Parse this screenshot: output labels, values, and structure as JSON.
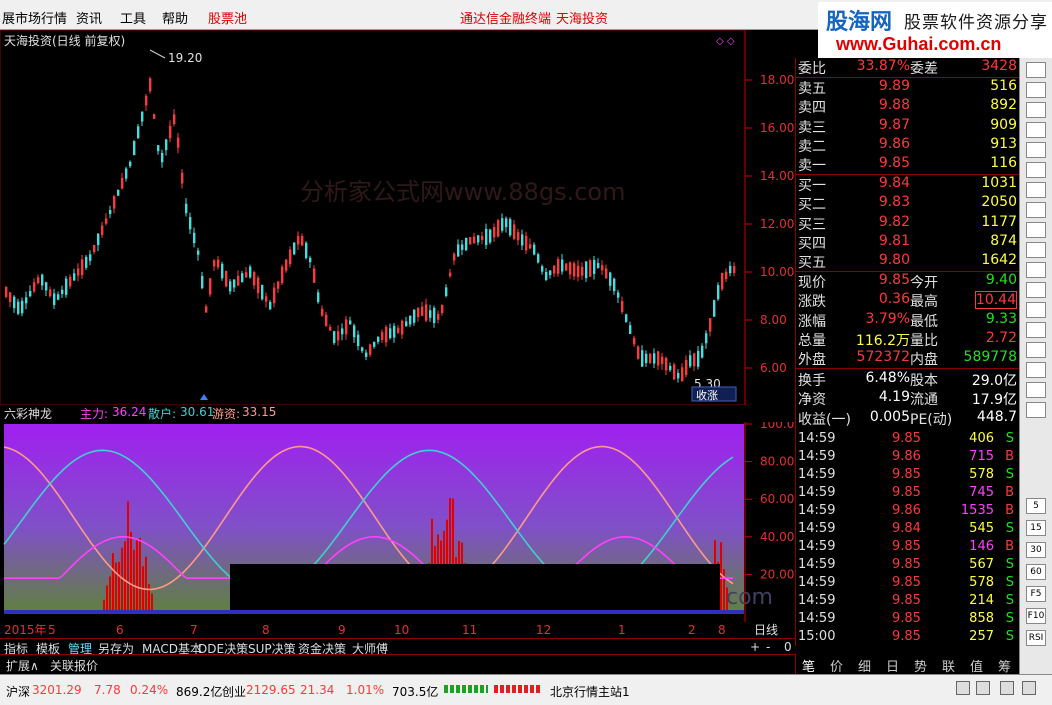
{
  "menu": {
    "items": [
      "展市场行情",
      "资讯",
      "工具",
      "帮助"
    ],
    "stock_pool": "股票池",
    "center_a": "通达信金融终端",
    "center_b": "天海投资"
  },
  "logo": {
    "title": "股海网",
    "subtitle": "股票软件资源分享",
    "url": "www.Guhai.com.cn"
  },
  "chart": {
    "title": "天海投资(日线 前复权)",
    "high_label": "19.20",
    "low_label": "5.30",
    "watermark": "分析家公式网www.88gs.com",
    "badge": "收涨",
    "y_ticks": [
      "18.00",
      "16.00",
      "14.00",
      "12.00",
      "10.00",
      "8.00",
      "6.00"
    ]
  },
  "indicator": {
    "name": "六彩神龙",
    "zhuli_label": "主力:",
    "zhuli_value": "36.24",
    "sanhu_label": "散户:",
    "sanhu_value": "30.61",
    "youzi_label": "游资:",
    "youzi_value": "33.15",
    "y_ticks": [
      "100.0",
      "80.00",
      "60.00",
      "40.00",
      "20.00"
    ],
    "watermark_tail": "com"
  },
  "xaxis": {
    "labels": [
      "2015年",
      "5",
      "6",
      "7",
      "8",
      "9",
      "10",
      "11",
      "12",
      "1",
      "2",
      "8"
    ],
    "period": "日线"
  },
  "tabs": [
    "指标",
    "模板",
    "管理",
    "另存为",
    "MACD基本",
    "DDE决策",
    "SUP决策",
    "资金决策",
    "大师傅"
  ],
  "tabs_row2": [
    "扩展∧",
    "关联报价"
  ],
  "zoom": {
    "plus": "+",
    "minus": "-",
    "zero": "0"
  },
  "quote": {
    "weibi_label": "委比",
    "weibi": "33.87%",
    "weicha_label": "委差",
    "weicha": "3428",
    "asks": [
      {
        "label": "卖五",
        "price": "9.89",
        "vol": "516"
      },
      {
        "label": "卖四",
        "price": "9.88",
        "vol": "892"
      },
      {
        "label": "卖三",
        "price": "9.87",
        "vol": "909"
      },
      {
        "label": "卖二",
        "price": "9.86",
        "vol": "913"
      },
      {
        "label": "卖一",
        "price": "9.85",
        "vol": "116"
      }
    ],
    "bids": [
      {
        "label": "买一",
        "price": "9.84",
        "vol": "1031"
      },
      {
        "label": "买二",
        "price": "9.83",
        "vol": "2050"
      },
      {
        "label": "买三",
        "price": "9.82",
        "vol": "1177"
      },
      {
        "label": "买四",
        "price": "9.81",
        "vol": "874"
      },
      {
        "label": "买五",
        "price": "9.80",
        "vol": "1642"
      }
    ],
    "stats": [
      {
        "l1": "现价",
        "v1": "9.85",
        "c1": "red",
        "l2": "今开",
        "v2": "9.40",
        "c2": "green"
      },
      {
        "l1": "涨跌",
        "v1": "0.36",
        "c1": "red",
        "l2": "最高",
        "v2": "10.44",
        "c2": "red"
      },
      {
        "l1": "涨幅",
        "v1": "3.79%",
        "c1": "red",
        "l2": "最低",
        "v2": "9.33",
        "c2": "green"
      },
      {
        "l1": "总量",
        "v1": "116.2万",
        "c1": "yellow",
        "l2": "量比",
        "v2": "2.72",
        "c2": "red"
      },
      {
        "l1": "外盘",
        "v1": "572372",
        "c1": "red",
        "l2": "内盘",
        "v2": "589778",
        "c2": "green"
      }
    ],
    "stats2": [
      {
        "l1": "换手",
        "v1": "6.48%",
        "l2": "股本",
        "v2": "29.0亿"
      },
      {
        "l1": "净资",
        "v1": "4.19",
        "l2": "流通",
        "v2": "17.9亿"
      },
      {
        "l1": "收益(一)",
        "v1": "0.005",
        "l2": "PE(动)",
        "v2": "448.7"
      }
    ]
  },
  "ticks": [
    {
      "time": "14:59",
      "price": "9.85",
      "vol": "406",
      "bs": "S"
    },
    {
      "time": "14:59",
      "price": "9.86",
      "vol": "715",
      "bs": "B"
    },
    {
      "time": "14:59",
      "price": "9.85",
      "vol": "578",
      "bs": "S"
    },
    {
      "time": "14:59",
      "price": "9.85",
      "vol": "745",
      "bs": "B"
    },
    {
      "time": "14:59",
      "price": "9.86",
      "vol": "1535",
      "bs": "B"
    },
    {
      "time": "14:59",
      "price": "9.84",
      "vol": "545",
      "bs": "S"
    },
    {
      "time": "14:59",
      "price": "9.85",
      "vol": "146",
      "bs": "B"
    },
    {
      "time": "14:59",
      "price": "9.85",
      "vol": "567",
      "bs": "S"
    },
    {
      "time": "14:59",
      "price": "9.85",
      "vol": "578",
      "bs": "S"
    },
    {
      "time": "14:59",
      "price": "9.85",
      "vol": "214",
      "bs": "S"
    },
    {
      "time": "14:59",
      "price": "9.85",
      "vol": "858",
      "bs": "S"
    },
    {
      "time": "15:00",
      "price": "9.85",
      "vol": "257",
      "bs": "S"
    }
  ],
  "right_tabs": [
    "笔",
    "价",
    "细",
    "日",
    "势",
    "联",
    "值",
    "筹"
  ],
  "tools": [
    "5",
    "15",
    "30",
    "60",
    "F5",
    "F10",
    "RSI"
  ],
  "status": {
    "sh_label": "沪深",
    "sh_index": "3201.29",
    "sh_chg": "7.78",
    "sh_pct": "0.24%",
    "sh_amt": "869.2亿",
    "cy_label": "创业",
    "cy_index": "2129.65",
    "cy_chg": "21.34",
    "cy_pct": "1.01%",
    "cy_amt": "703.5亿",
    "server": "北京行情主站1"
  },
  "colors": {
    "up": "#ff3838",
    "down": "#40e0e0",
    "zhuli": "#ff40ff",
    "sanhu": "#40d0d0",
    "youzi": "#ff9a8a"
  }
}
